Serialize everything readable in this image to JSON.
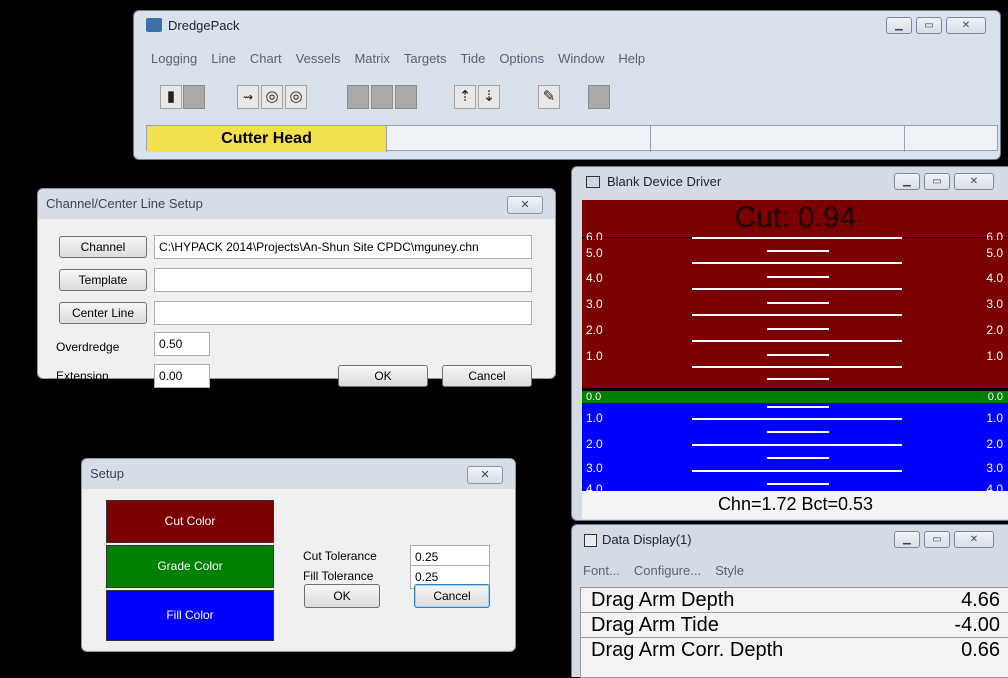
{
  "dredgepack": {
    "title": "DredgePack",
    "menu": [
      "Logging",
      "Line",
      "Chart",
      "Vessels",
      "Matrix",
      "Targets",
      "Tide",
      "Options",
      "Window",
      "Help"
    ],
    "status_label": "Cutter Head",
    "colors": {
      "status_bg": "#f4e04d"
    }
  },
  "channel_dialog": {
    "title": "Channel/Center Line Setup",
    "channel_label": "Channel",
    "channel_value": "C:\\HYPACK 2014\\Projects\\An-Shun Site CPDC\\mguney.chn",
    "template_label": "Template",
    "template_value": "",
    "centerline_label": "Center Line",
    "centerline_value": "",
    "overdredge_label": "Overdredge",
    "overdredge_value": "0.50",
    "extension_label": "Extension",
    "extension_value": "0.00",
    "ok_label": "OK",
    "cancel_label": "Cancel"
  },
  "setup_dialog": {
    "title": "Setup",
    "cut_color_label": "Cut Color",
    "grade_color_label": "Grade Color",
    "fill_color_label": "Fill Color",
    "cut_tolerance_label": "Cut Tolerance",
    "cut_tolerance_value": "0.25",
    "fill_tolerance_label": "Fill Tolerance",
    "fill_tolerance_value": "0.25",
    "ok_label": "OK",
    "cancel_label": "Cancel",
    "colors": {
      "cut": "#7b0000",
      "grade": "#008000",
      "fill": "#0000ff"
    }
  },
  "blank_device": {
    "title": "Blank Device Driver",
    "cut_text": "Cut: 0.94",
    "scale_cut": [
      "6.0",
      "5.0",
      "4.0",
      "3.0",
      "2.0",
      "1.0"
    ],
    "scale_grade": "0.0",
    "scale_fill": [
      "1.0",
      "2.0",
      "3.0",
      "4.0"
    ],
    "footer": "Chn=1.72 Bct=0.53"
  },
  "data_display": {
    "title": "Data Display(1)",
    "menu": [
      "Font...",
      "Configure...",
      "Style"
    ],
    "rows": [
      {
        "name": "Drag Arm Depth",
        "value": "4.66"
      },
      {
        "name": "Drag Arm Tide",
        "value": "-4.00"
      },
      {
        "name": "Drag Arm Corr. Depth",
        "value": "0.66"
      }
    ]
  }
}
